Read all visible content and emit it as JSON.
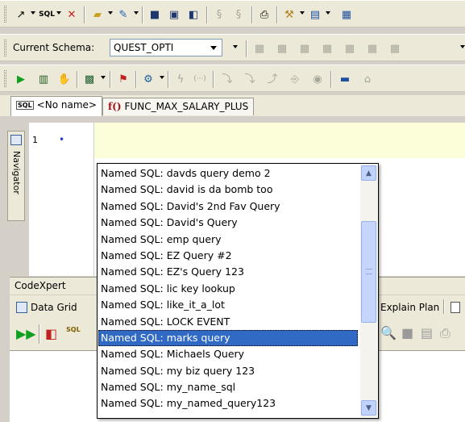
{
  "schema": {
    "label": "Current Schema:",
    "value": "QUEST_OPTI"
  },
  "tabs": [
    {
      "badge": "SQL",
      "label": "<No name>"
    },
    {
      "badge": "f()",
      "label": "FUNC_MAX_SALARY_PLUS"
    }
  ],
  "navigator": {
    "label": "Navigator"
  },
  "editor": {
    "line_number": "1"
  },
  "codexpert": {
    "label": "CodeXpert"
  },
  "results": {
    "data_grid_label": "Data Grid",
    "explain_plan_label": "Explain Plan"
  },
  "popup": {
    "items": [
      "Named SQL: davds query demo 2",
      "Named SQL: david is da bomb too",
      "Named SQL: David's 2nd Fav Query",
      "Named SQL: David's Query",
      "Named SQL: emp query",
      "Named SQL: EZ Query #2",
      "Named SQL: EZ's Query 123",
      "Named SQL: lic key lookup",
      "Named SQL: like_it_a_lot",
      "Named SQL: LOCK EVENT",
      "Named SQL: marks query",
      "Named SQL: Michaels Query",
      "Named SQL: my biz query 123",
      "Named SQL: my_name_sql",
      "Named SQL: my_named_query123"
    ],
    "selected_item": "Named SQL: marks query"
  },
  "colors": {
    "selection": "#316ac5",
    "current_line": "#fbfed9",
    "toolbar": "#ece9d8"
  }
}
